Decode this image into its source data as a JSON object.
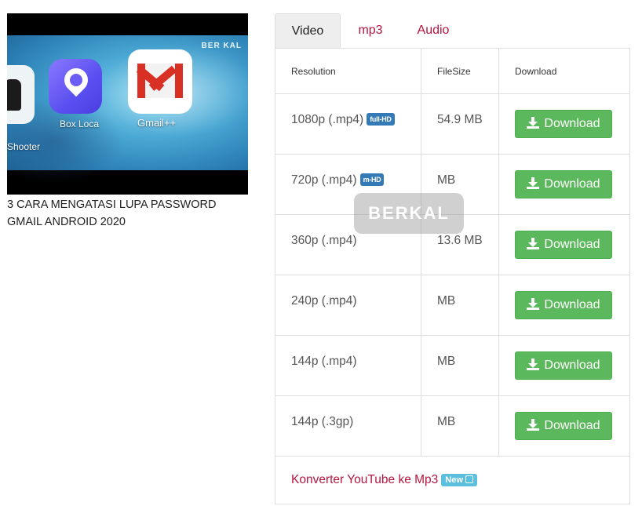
{
  "video": {
    "title": "3 CARA MENGATASI LUPA PASSWORD GMAIL ANDROID 2020",
    "thumbnail": {
      "watermark": "BER KAL",
      "app_labels": [
        "Shooter",
        "Box Loca",
        "Gmail++"
      ]
    }
  },
  "tabs": [
    {
      "label": "Video",
      "active": true
    },
    {
      "label": "mp3",
      "active": false
    },
    {
      "label": "Audio",
      "active": false
    }
  ],
  "table": {
    "headers": [
      "Resolution",
      "FileSize",
      "Download"
    ],
    "rows": [
      {
        "resolution": "1080p (.mp4)",
        "badge": "full-HD",
        "filesize": "54.9 MB",
        "button": "Download"
      },
      {
        "resolution": "720p (.mp4)",
        "badge": "m-HD",
        "filesize": "MB",
        "button": "Download"
      },
      {
        "resolution": "360p (.mp4)",
        "badge": "",
        "filesize": "13.6 MB",
        "button": "Download"
      },
      {
        "resolution": "240p (.mp4)",
        "badge": "",
        "filesize": "MB",
        "button": "Download"
      },
      {
        "resolution": "144p (.mp4)",
        "badge": "",
        "filesize": "MB",
        "button": "Download"
      },
      {
        "resolution": "144p (.3gp)",
        "badge": "",
        "filesize": "MB",
        "button": "Download"
      }
    ]
  },
  "footer": {
    "link": "Konverter YouTube ke Mp3",
    "badge": "New"
  },
  "watermark": "BERKAL",
  "colors": {
    "accent_link": "#b5153e",
    "download_button": "#5cb85c",
    "badge_blue": "#337ab7",
    "badge_new": "#5bc0de"
  }
}
